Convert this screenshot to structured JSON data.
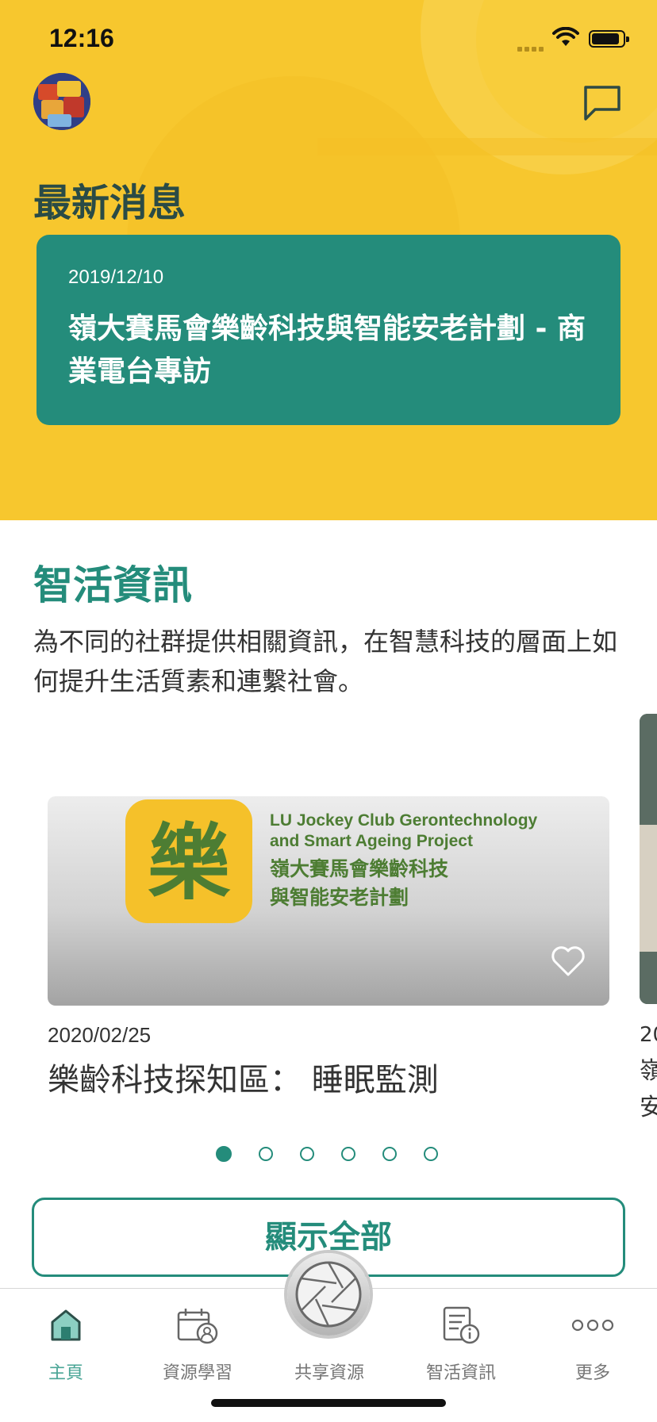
{
  "status_bar": {
    "time": "12:16",
    "battery_level": 0.9
  },
  "header": {
    "news_section_title": "最新消息",
    "news_card": {
      "date": "2019/12/10",
      "title": "嶺大賽馬會樂齡科技與智能安老計劃 - 商業電台專訪"
    }
  },
  "smart_info": {
    "title": "智活資訊",
    "description": "為不同的社群提供相關資訊，在智慧科技的層面上如何提升生活質素和連繫社會。",
    "card": {
      "logo_text_en_1": "LU Jockey Club Gerontechnology",
      "logo_text_en_2": "and Smart Ageing Project",
      "logo_text_zh_1": "嶺大賽馬會樂齡科技",
      "logo_text_zh_2": "與智能安老計劃",
      "logo_glyph": "樂",
      "date": "2020/02/25",
      "title": "樂齡科技探知區：  睡眠監測"
    },
    "peek_card": {
      "date_fragment": "20",
      "title_fragment_1": "嶺",
      "title_fragment_2": "安"
    },
    "pagination": {
      "total": 6,
      "active": 1
    },
    "show_all_label": "顯示全部"
  },
  "tab_bar": {
    "items": [
      {
        "label": "主頁",
        "icon": "home-icon",
        "active": true
      },
      {
        "label": "資源學習",
        "icon": "calendar-user-icon",
        "active": false
      },
      {
        "label": "共享資源",
        "icon": "camera-aperture-icon",
        "active": false
      },
      {
        "label": "智活資訊",
        "icon": "document-info-icon",
        "active": false
      },
      {
        "label": "更多",
        "icon": "more-icon",
        "active": false
      }
    ]
  },
  "colors": {
    "primary": "#248C7B",
    "header_yellow": "#F7C72E",
    "logo_green": "#4d7d33"
  }
}
